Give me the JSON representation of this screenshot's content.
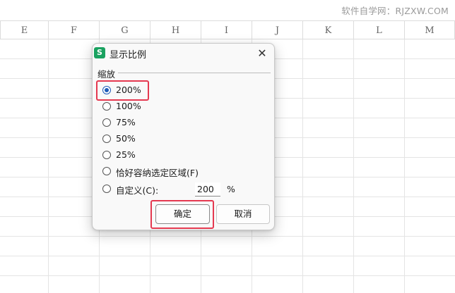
{
  "watermark": "软件自学网：RJZXW.COM",
  "columns": [
    "E",
    "F",
    "G",
    "H",
    "I",
    "J",
    "K",
    "L",
    "M"
  ],
  "dialog": {
    "icon_letter": "S",
    "title": "显示比例",
    "close_symbol": "✕",
    "section_label": "缩放",
    "options": [
      {
        "label": "200%",
        "checked": true
      },
      {
        "label": "100%",
        "checked": false
      },
      {
        "label": "75%",
        "checked": false
      },
      {
        "label": "50%",
        "checked": false
      },
      {
        "label": "25%",
        "checked": false
      },
      {
        "label": "恰好容纳选定区域(F)",
        "checked": false
      },
      {
        "label": "自定义(C):",
        "checked": false
      }
    ],
    "custom_value": "200",
    "percent_sign": "%",
    "ok_label": "确定",
    "cancel_label": "取消"
  },
  "colors": {
    "accent": "#1e5bb8",
    "highlight": "#e53950",
    "app_icon": "#1aa260"
  }
}
